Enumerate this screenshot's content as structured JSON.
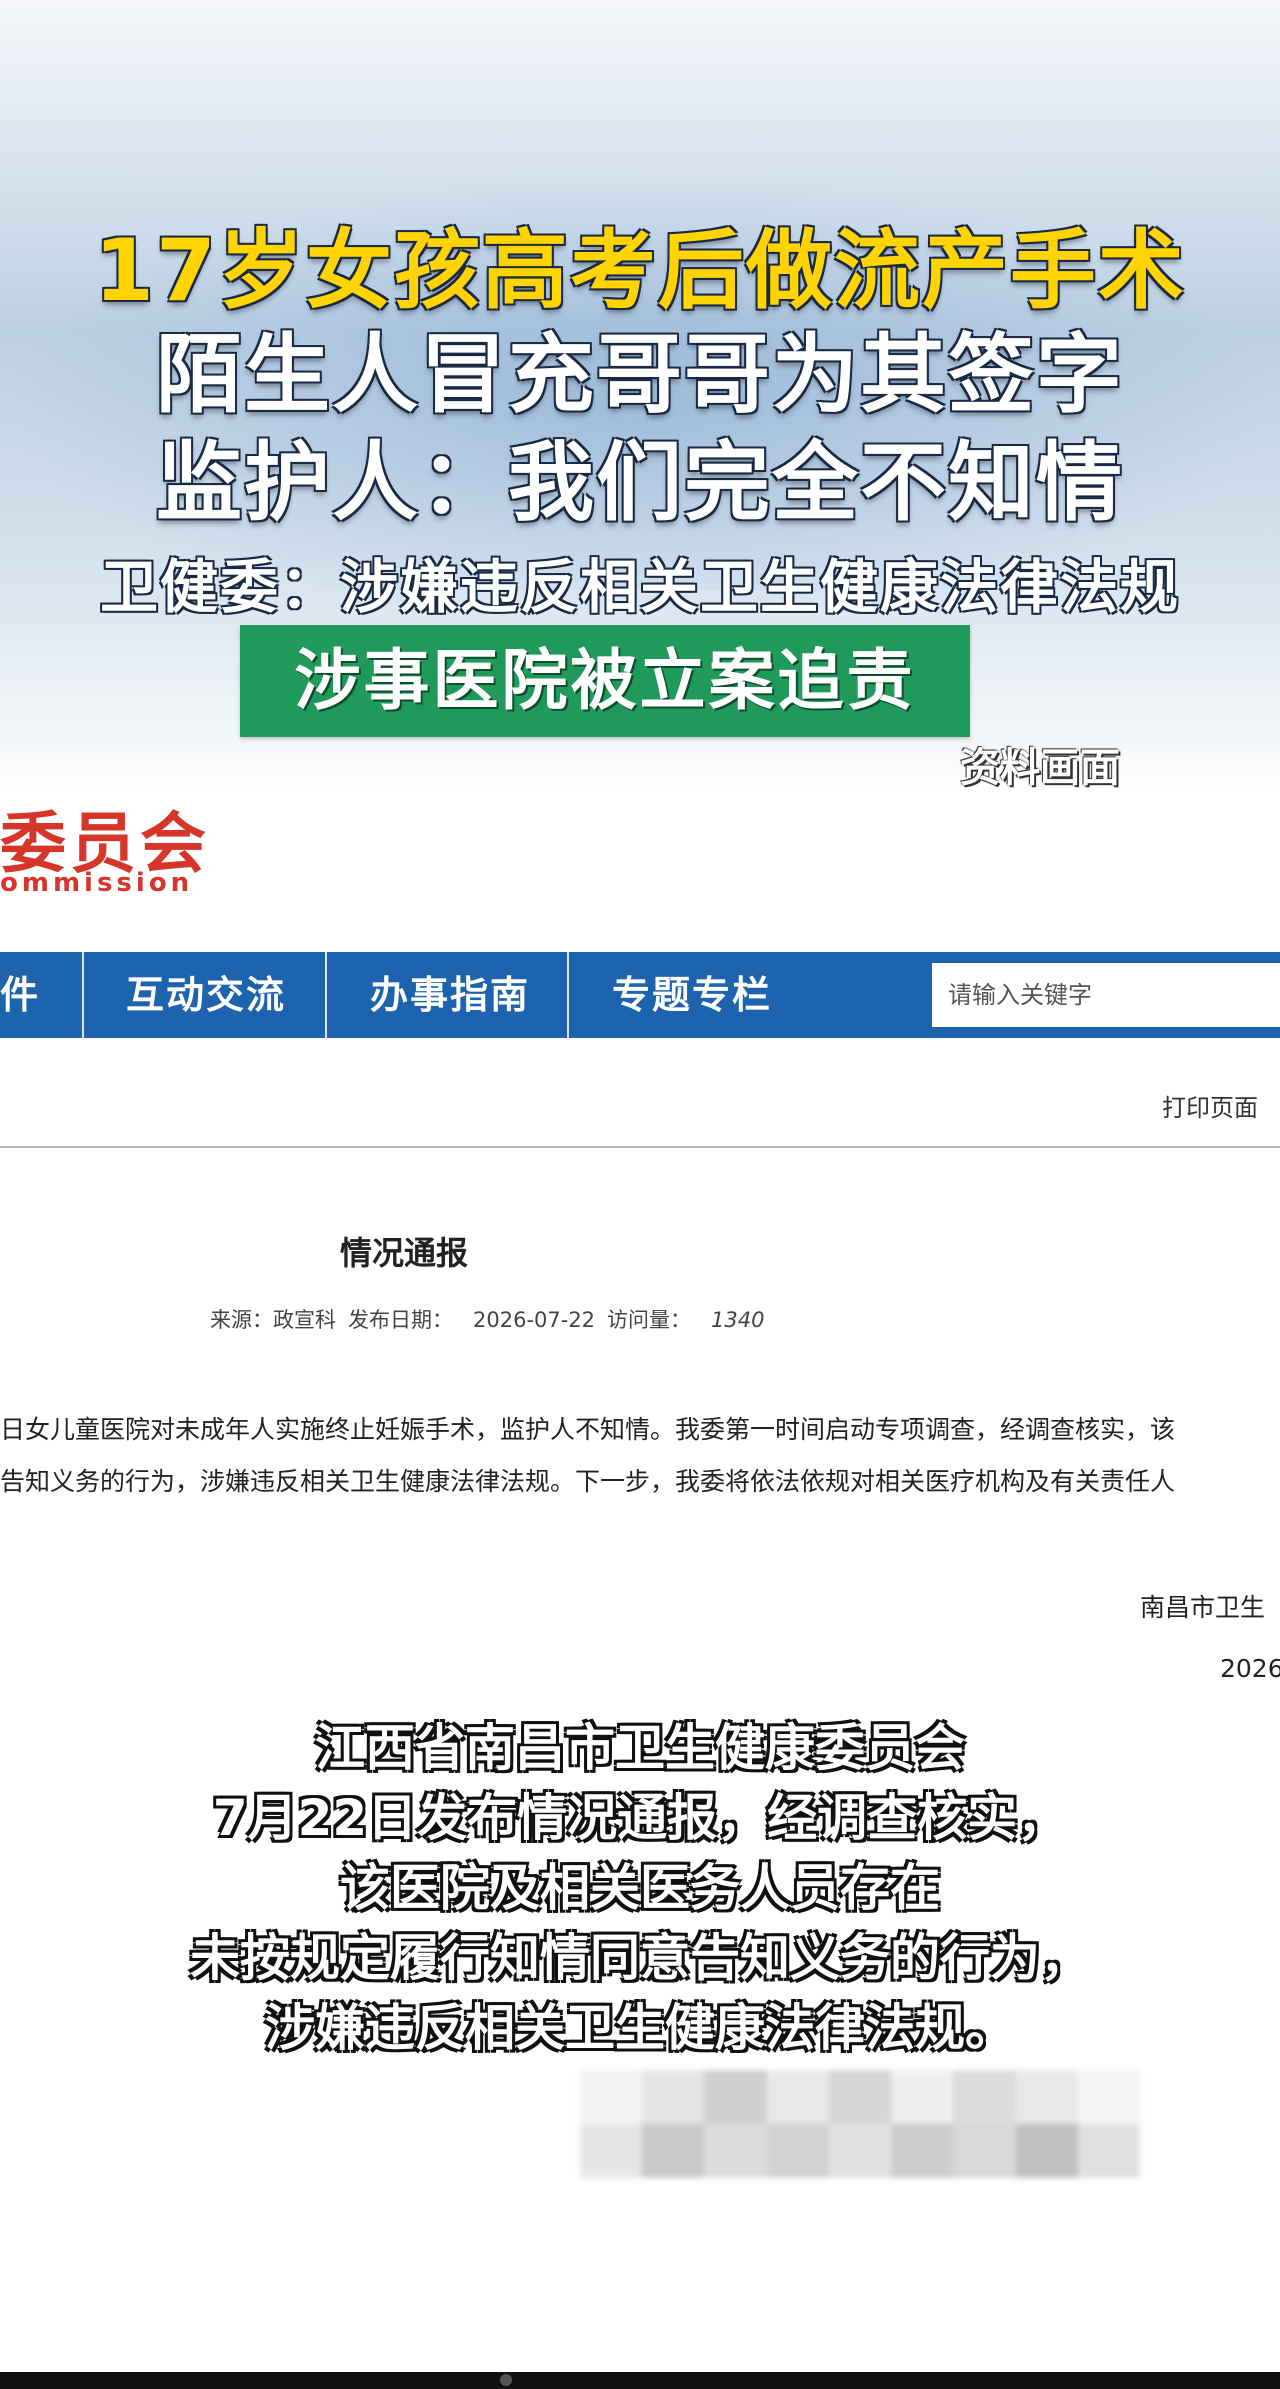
{
  "banner": {
    "headline_1": "17岁女孩高考后做流产手术",
    "headline_2": "陌生人冒充哥哥为其签字",
    "headline_3": "监护人：我们完全不知情",
    "subheadline": "卫健委：涉嫌违反相关卫生健康法律法规",
    "tag": "涉事医院被立案追责",
    "source_label": "资料画面"
  },
  "site": {
    "logo_cn": "委员会",
    "logo_en": "ommission",
    "nav": [
      "件",
      "互动交流",
      "办事指南",
      "专题专栏"
    ],
    "search_placeholder": "请输入关键字",
    "print_label": "打印页面"
  },
  "article": {
    "title": "情况通报",
    "meta": {
      "source_label": "来源：政宣科",
      "date_label": "发布日期：",
      "date": "2026-07-22",
      "views_label": "访问量：",
      "views": "1340"
    },
    "body_lines": [
      "日女儿童医院对未成年人实施终止妊娠手术，监护人不知情。我委第一时间启动专项调查，经调查核实，该",
      "告知义务的行为，涉嫌违反相关卫生健康法律法规。下一步，我委将依法依规对相关医疗机构及有关责任人"
    ],
    "signature_org": "南昌市卫生",
    "signature_date": "2026"
  },
  "caption": {
    "lines": [
      "江西省南昌市卫生健康委员会",
      "7月22日发布情况通报，经调查核实，",
      "该医院及相关医务人员存在",
      "未按规定履行知情同意告知义务的行为，",
      "涉嫌违反相关卫生健康法律法规。"
    ]
  },
  "colors": {
    "headline_yellow": "#ffd400",
    "tag_green": "#1f9a5b",
    "nav_blue": "#1d63ad",
    "logo_red": "#d8352a"
  }
}
